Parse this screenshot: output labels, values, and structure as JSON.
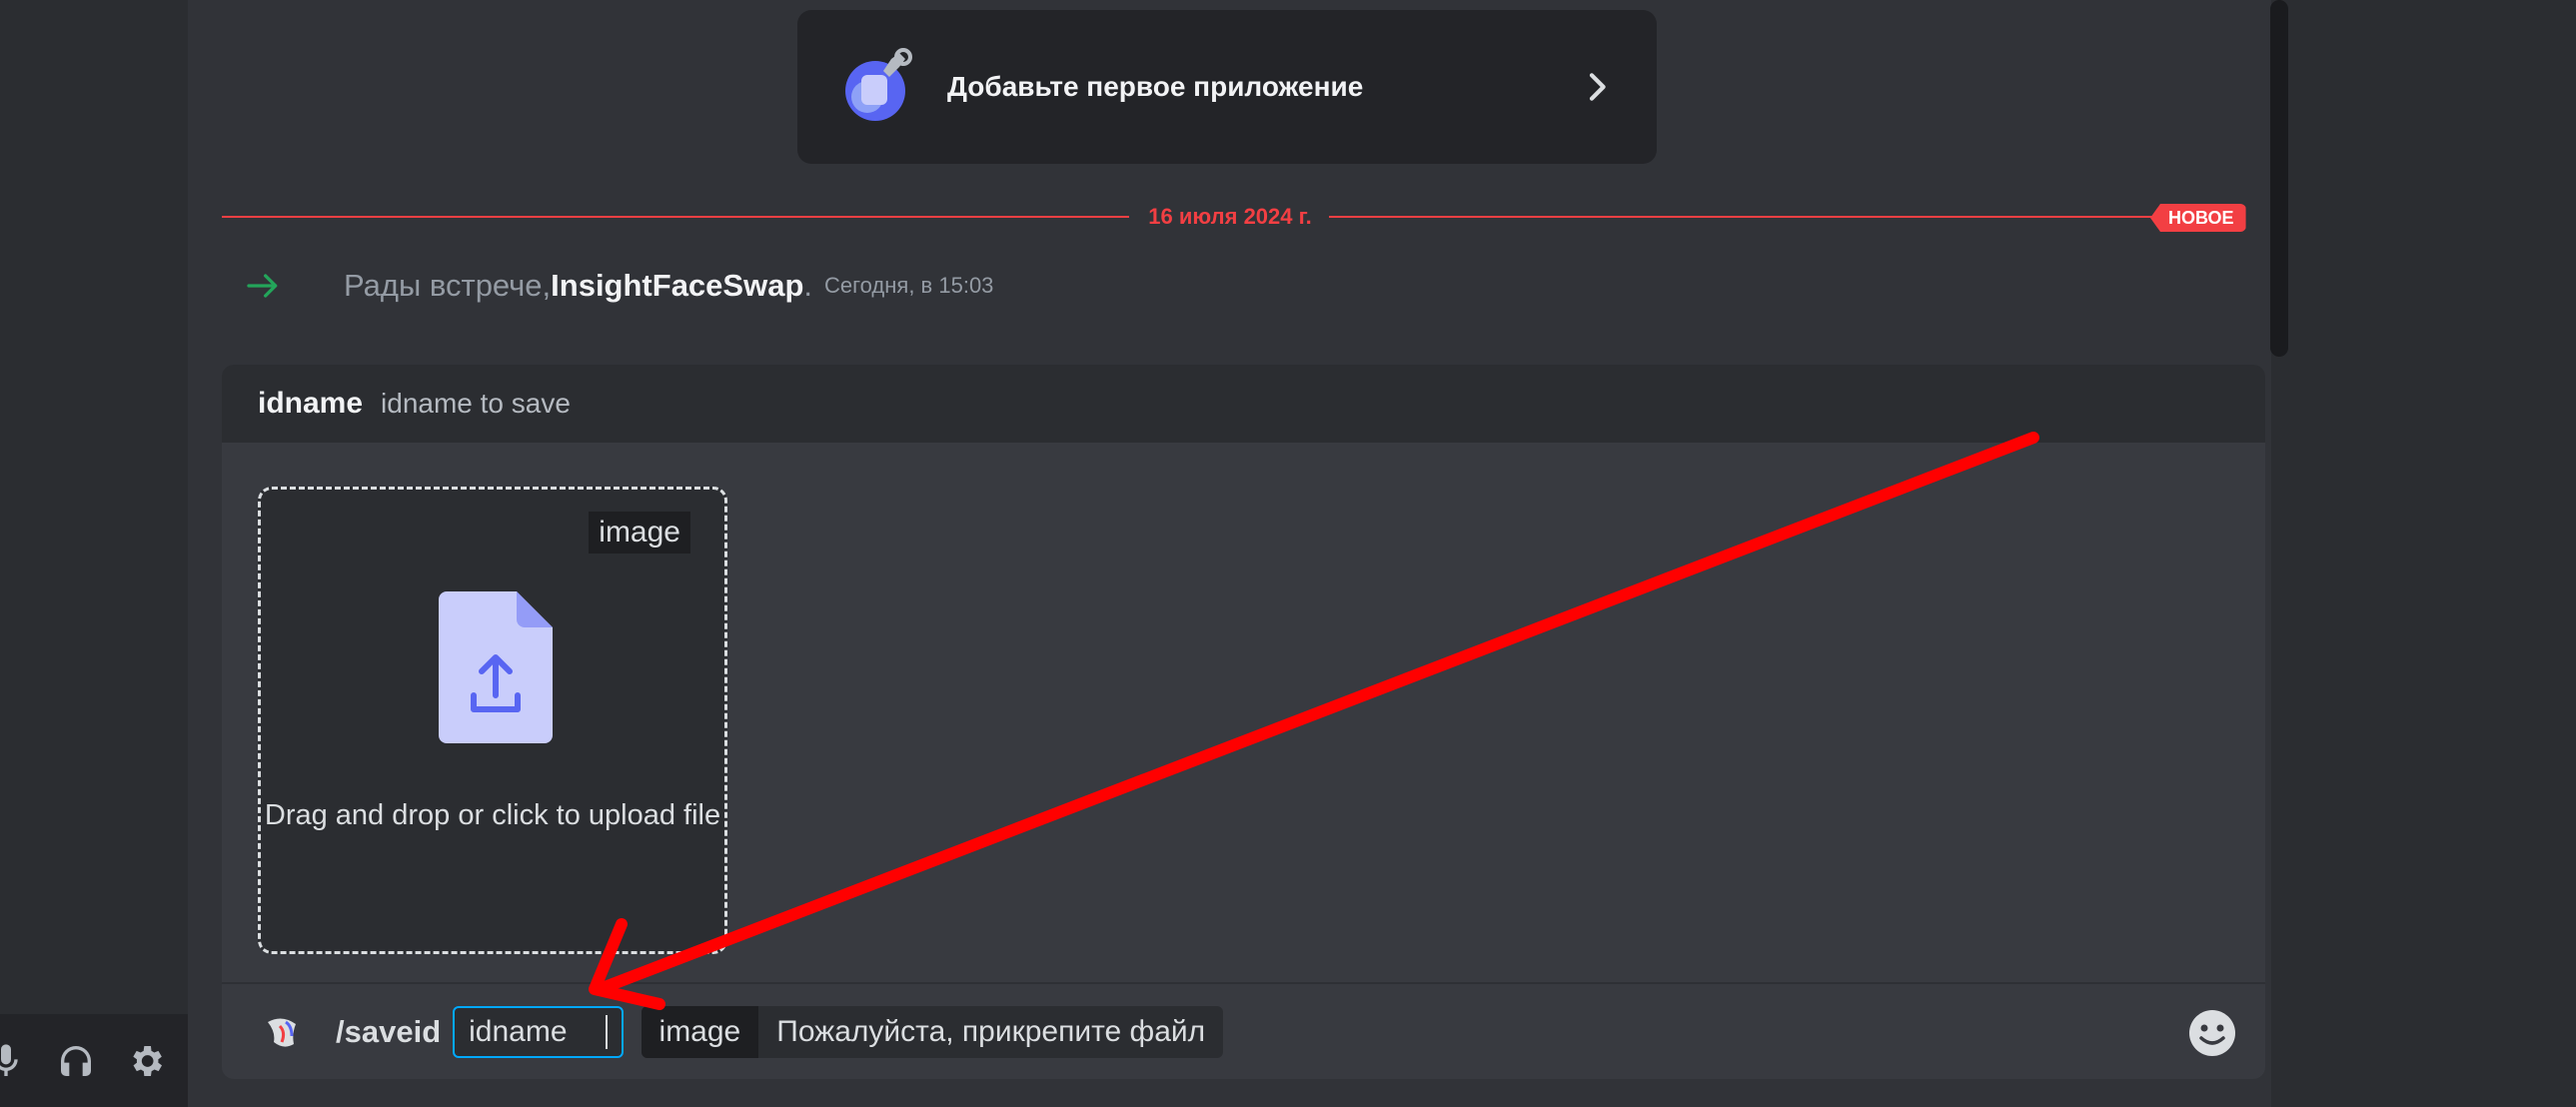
{
  "app_card": {
    "label": "Добавьте первое приложение"
  },
  "divider": {
    "date": "16 июля 2024 г.",
    "badge": "НОВОЕ"
  },
  "join_message": {
    "prefix": "Рады встрече, ",
    "username": "InsightFaceSwap",
    "suffix": ".",
    "timestamp": "Сегодня, в 15:03"
  },
  "command": {
    "name": "idname",
    "description": "idname to save",
    "upload": {
      "tag": "image",
      "text": "Drag and drop or click to upload file"
    },
    "input": {
      "slash": "/saveid",
      "option_name": "idname",
      "required_option": "image",
      "required_hint": "Пожалуйста, прикрепите файл"
    }
  },
  "colors": {
    "accent_red": "#f23f43",
    "focus_blue": "#00a8fc",
    "upload_purple": "#5865f2",
    "file_bg": "#c9cdfb",
    "annotation_red": "#ff0000"
  }
}
